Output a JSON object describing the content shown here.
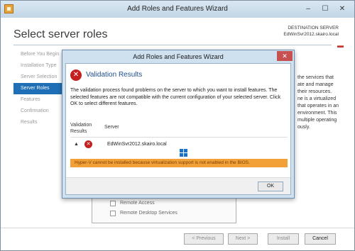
{
  "window": {
    "title": "Add Roles and Features Wizard",
    "controls": {
      "minimize": "–",
      "maximize": "☐",
      "close": "✕"
    }
  },
  "header": {
    "page_title": "Select server roles",
    "destination_label": "DESTINATION SERVER",
    "destination_server": "EdWinSvr2012.skairo.local"
  },
  "nav": {
    "items": [
      {
        "label": "Before You Begin"
      },
      {
        "label": "Installation Type"
      },
      {
        "label": "Server Selection"
      },
      {
        "label": "Server Roles",
        "active": true
      },
      {
        "label": "Features"
      },
      {
        "label": "Confirmation"
      },
      {
        "label": "Results"
      }
    ]
  },
  "description": {
    "lines": [
      "the services that",
      "ate and manage",
      "their resources.",
      "ne is a virtualized",
      "that operates in an",
      "environment. This",
      "multiple operating",
      "ously."
    ]
  },
  "roles": {
    "items": [
      {
        "label": "Remote Access"
      },
      {
        "label": "Remote Desktop Services"
      }
    ]
  },
  "footer": {
    "previous": "< Previous",
    "next": "Next >",
    "install": "Install",
    "cancel": "Cancel"
  },
  "dialog": {
    "title": "Add Roles and Features Wizard",
    "close": "✕",
    "heading": "Validation Results",
    "message": "The validation process found problems on the server to which you want to install features. The selected features are not compatible with the current configuration of your selected server.  Click OK to select different features.",
    "col_validation": "Validation Results",
    "col_server": "Server",
    "row_server": "EdWinSvr2012.skairo.local",
    "error": "Hyper-V cannot be installed because virtualization support is not enabled in the BIOS.",
    "ok": "OK"
  }
}
